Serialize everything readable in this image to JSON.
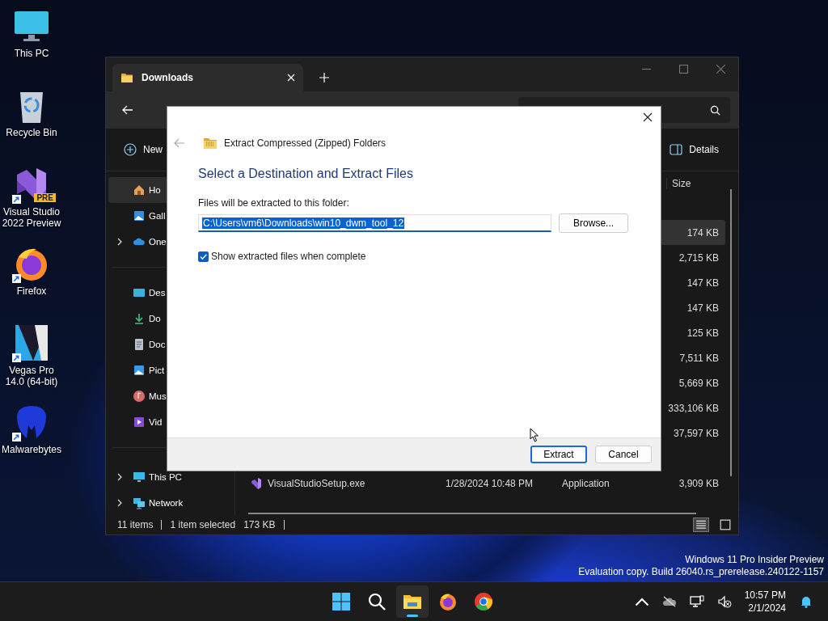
{
  "desktop_icons": [
    {
      "label": "This PC",
      "kind": "monitor",
      "shortcut": false
    },
    {
      "label": "Recycle Bin",
      "kind": "recycle-bin",
      "shortcut": false
    },
    {
      "label": "Visual Studio 2022 Preview",
      "kind": "visual-studio",
      "badge": "PRE",
      "shortcut": true
    },
    {
      "label": "Firefox",
      "kind": "firefox",
      "shortcut": true
    },
    {
      "label": "Vegas Pro 14.0 (64-bit)",
      "kind": "vegas",
      "shortcut": true
    },
    {
      "label": "Malwarebytes",
      "kind": "malwarebytes",
      "shortcut": true
    }
  ],
  "explorer": {
    "tab": {
      "title": "Downloads"
    },
    "new_button": "New",
    "details_button": "Details",
    "sidebar_groups": [
      [
        {
          "label": "Ho",
          "kind": "home",
          "selected": true
        },
        {
          "label": "Gall",
          "kind": "gallery",
          "selected": false
        },
        {
          "label": "One",
          "kind": "cloud",
          "selected": false,
          "expanded": false
        }
      ],
      [
        {
          "label": "Des",
          "kind": "desktop",
          "selected": false
        },
        {
          "label": "Do",
          "kind": "download",
          "selected": false
        },
        {
          "label": "Doc",
          "kind": "document",
          "selected": false
        },
        {
          "label": "Pict",
          "kind": "pictures",
          "selected": false
        },
        {
          "label": "Mus",
          "kind": "music",
          "selected": false
        },
        {
          "label": "Vid",
          "kind": "video",
          "selected": false
        }
      ],
      [
        {
          "label": "This PC",
          "kind": "monitor",
          "selected": false,
          "expanded": false
        },
        {
          "label": "Network",
          "kind": "network",
          "selected": false,
          "expanded": false
        }
      ]
    ],
    "size_column": "Size",
    "size_rows": [
      {
        "size": "174 KB",
        "selected": true
      },
      {
        "size": "2,715 KB",
        "selected": false
      },
      {
        "size": "147 KB",
        "selected": false
      },
      {
        "size": "147 KB",
        "selected": false
      },
      {
        "size": "125 KB",
        "selected": false
      },
      {
        "size": "7,511 KB",
        "selected": false
      },
      {
        "size": "5,669 KB",
        "selected": false
      },
      {
        "size": "333,106 KB",
        "selected": false
      },
      {
        "size": "37,597 KB",
        "selected": false
      }
    ],
    "file_rows": [
      {
        "name": "VisualStudioSetup.exe",
        "date": "1/28/2024 10:48 PM",
        "type": "Application",
        "size": "3,909 KB",
        "selected": false
      }
    ],
    "status_bar": {
      "items": "11 items",
      "selection": "1 item selected",
      "selection_size": "173 KB"
    },
    "view_buttons": [
      {
        "kind": "details",
        "selected": true
      },
      {
        "kind": "tiles",
        "selected": false
      }
    ]
  },
  "dialog": {
    "title": "Extract Compressed (Zipped) Folders",
    "heading": "Select a Destination and Extract Files",
    "folder_label": "Files will be extracted to this folder:",
    "path": "C:\\Users\\vm6\\Downloads\\win10_dwm_tool_12",
    "path_selected": true,
    "browse_button": "Browse...",
    "show_files": {
      "label": "Show extracted files when complete",
      "checked": true
    },
    "buttons": [
      {
        "label": "Extract",
        "default": true
      },
      {
        "label": "Cancel",
        "default": false
      }
    ]
  },
  "build_info": [
    "Windows 11 Pro Insider Preview",
    "Evaluation copy. Build 26040.rs_prerelease.240122-1157"
  ],
  "taskbar": {
    "apps": [
      {
        "kind": "start",
        "active": false
      },
      {
        "kind": "search",
        "active": false
      },
      {
        "kind": "file-explorer",
        "active": true
      },
      {
        "kind": "firefox",
        "active": false
      },
      {
        "kind": "chrome",
        "active": false
      }
    ],
    "time": "10:57 PM",
    "date": "2/1/2024"
  }
}
